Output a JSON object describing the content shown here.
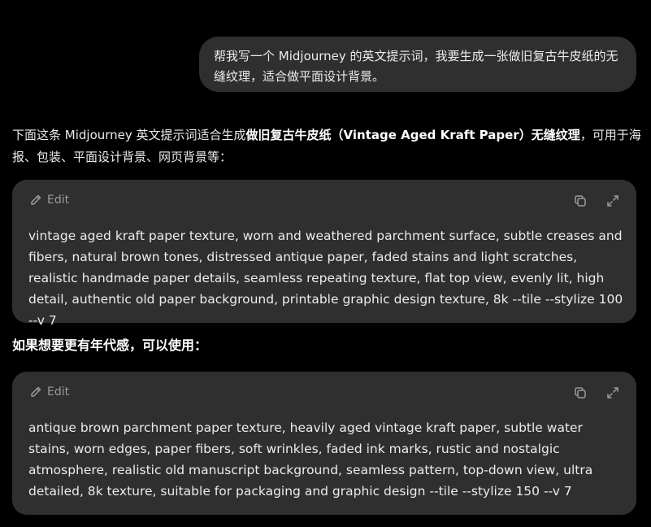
{
  "user_message": {
    "text": "帮我写一个 Midjourney 的英文提示词，我要生成一张做旧复古牛皮纸的无缝纹理，适合做平面设计背景。"
  },
  "assistant": {
    "intro_before": "下面这条 Midjourney 英文提示词适合生成",
    "intro_bold": "做旧复古牛皮纸（Vintage Aged Kraft Paper）无缝纹理",
    "intro_after": "，可用于海报、包装、平面设计背景、网页背景等：",
    "code_blocks": [
      {
        "edit_label": "Edit",
        "content": "vintage aged kraft paper texture, worn and weathered parchment surface, subtle creases and fibers, natural brown tones, distressed antique paper, faded stains and light scratches, realistic handmade paper details, seamless repeating texture, flat top view, evenly lit, high detail, authentic old paper background, printable graphic design texture, 8k --tile --stylize 100 --v 7"
      },
      {
        "edit_label": "Edit",
        "content": "antique brown parchment paper texture, heavily aged vintage kraft paper, subtle water stains, worn edges, paper fibers, soft wrinkles, faded ink marks, rustic and nostalgic atmosphere, realistic old manuscript background, seamless pattern, top-down view, ultra detailed, 8k texture, suitable for packaging and graphic design --tile --stylize 150 --v 7"
      }
    ],
    "section_heading": "如果想要更有年代感，可以使用："
  },
  "icons": {
    "edit": "pencil-icon",
    "copy": "copy-icon",
    "expand": "expand-icon"
  },
  "colors": {
    "background": "#000000",
    "bubble": "#2f2f2f",
    "text": "#ececec",
    "muted": "#9b9b9b"
  }
}
